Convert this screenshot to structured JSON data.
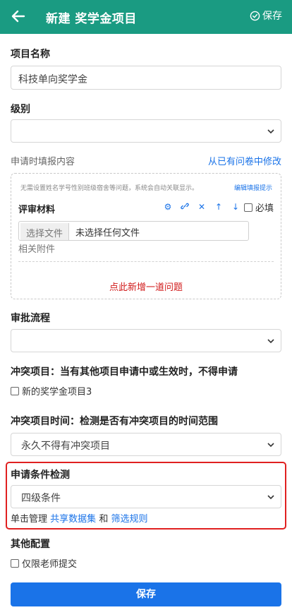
{
  "header": {
    "title": "新建 奖学金项目",
    "save_label": "保存",
    "background": "#1a9b82"
  },
  "form": {
    "project_name": {
      "label": "项目名称",
      "value": "科技单向奖学金"
    },
    "level": {
      "label": "级别",
      "value": ""
    },
    "apply_content": {
      "label": "申请时填报内容",
      "modify_link": "从已有问卷中修改",
      "hint": "无需设置姓名学号性别班级宿舍等问题，系统会自动关联显示。",
      "hint_link": "编辑填报提示",
      "material_title": "评审材料",
      "tool_icons": [
        "gear-icon",
        "link-icon",
        "close-icon",
        "arrow-up-icon",
        "arrow-down-icon"
      ],
      "required_label": "必填",
      "file_button": "选择文件",
      "file_text": "未选择任何文件",
      "attachment_label": "相关附件",
      "add_question": "点此新增一道问题"
    },
    "approval_flow": {
      "label": "审批流程",
      "value": ""
    },
    "conflict": {
      "label": "冲突项目：当有其他项目申请中或生效时，不得申请",
      "option": "新的奖学金项目3"
    },
    "conflict_time": {
      "label": "冲突项目时间：检测是否有冲突项目的时间范围",
      "value": "永久不得有冲突项目"
    },
    "condition_check": {
      "label": "申请条件检测",
      "value": "四级条件",
      "manage_prefix": "单击管理",
      "dataset_link": "共享数据集",
      "and": "和",
      "filter_link": "筛选规则"
    },
    "other": {
      "label": "其他配置",
      "teacher_only": "仅限老师提交"
    },
    "submit_label": "保存"
  }
}
